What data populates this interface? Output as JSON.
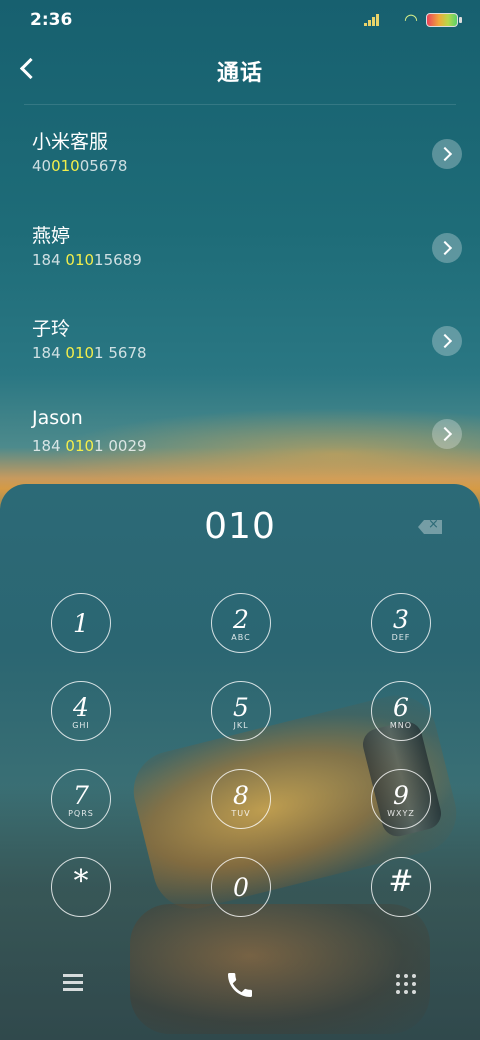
{
  "status_bar": {
    "time": "2:36"
  },
  "header": {
    "title": "通话"
  },
  "contacts": [
    {
      "name": "小米客服",
      "number_pre": "40",
      "number_match": "010",
      "number_post": "05678"
    },
    {
      "name": "燕婷",
      "number_pre": "184 ",
      "number_match": "010",
      "number_post": "15689"
    },
    {
      "name": "子玲",
      "number_pre": "184 ",
      "number_match": "010",
      "number_post": "1 5678"
    },
    {
      "name": "Jason",
      "number_pre": "184 ",
      "number_match": "010",
      "number_post": "1 0029"
    }
  ],
  "dialer": {
    "input": "010",
    "keys": [
      {
        "num": "1",
        "letters": ""
      },
      {
        "num": "2",
        "letters": "ABC"
      },
      {
        "num": "3",
        "letters": "DEF"
      },
      {
        "num": "4",
        "letters": "GHI"
      },
      {
        "num": "5",
        "letters": "JKL"
      },
      {
        "num": "6",
        "letters": "MNO"
      },
      {
        "num": "7",
        "letters": "PQRS"
      },
      {
        "num": "8",
        "letters": "TUV"
      },
      {
        "num": "9",
        "letters": "WXYZ"
      },
      {
        "num": "*",
        "letters": ""
      },
      {
        "num": "0",
        "letters": ""
      },
      {
        "num": "#",
        "letters": ""
      }
    ]
  },
  "colors": {
    "highlight": "#f3ee4b",
    "accent_bg": "#2c6a77"
  },
  "icons": {
    "back": "back-arrow-icon",
    "delete": "backspace-icon",
    "menu": "menu-icon",
    "call": "phone-icon",
    "dialpad": "dialpad-icon"
  }
}
